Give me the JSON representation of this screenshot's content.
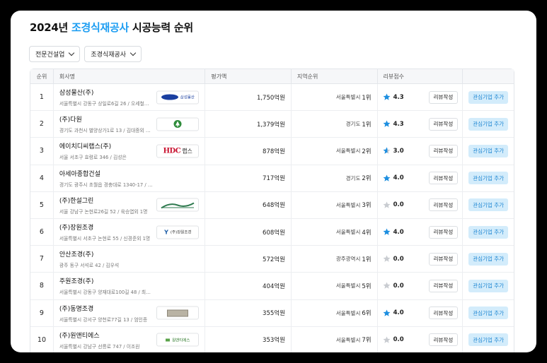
{
  "page": {
    "title_year": "2024년 ",
    "title_accent": "조경식재공사",
    "title_rest": " 시공능력 순위"
  },
  "filters": [
    {
      "label": "전문건설업"
    },
    {
      "label": "조경식재공사"
    }
  ],
  "colors": {
    "accent": "#1e9ef2",
    "star_active": "#1e8fe0",
    "star_inactive": "#c9ccd1",
    "fav_bg": "#d3ecfb"
  },
  "table": {
    "headers": {
      "rank": "순위",
      "name": "회사명",
      "score": "평가액",
      "region": "지역순위",
      "review": "리뷰점수"
    },
    "review_button": "리뷰작성",
    "fav_button": "관심기업 추가",
    "rows": [
      {
        "rank": "1",
        "name": "삼성물산(주)",
        "addr": "서울특별시 강동구 상일로6길 26 / 오세철…",
        "score": "1,750억원",
        "region": "서울특별시",
        "region_rank": "1위",
        "rating": "4.3",
        "star": "full",
        "logo": "samsung-cnt-logo",
        "logo_text": "삼성물산"
      },
      {
        "rank": "2",
        "name": "(주)다원",
        "addr": "경기도 과천시 별양상가1로 13 / 김대중외 …",
        "score": "1,379억원",
        "region": "경기도",
        "region_rank": "1위",
        "rating": "4.3",
        "star": "full",
        "logo": "tree-emblem-logo",
        "logo_text": ""
      },
      {
        "rank": "3",
        "name": "에이치디씨랩스(주)",
        "addr": "서울 서초구 효령로 346 / 김성은",
        "score": "878억원",
        "region": "서울특별시",
        "region_rank": "2위",
        "rating": "3.0",
        "star": "partial",
        "logo": "hdc-labs-logo",
        "logo_text": "랩스"
      },
      {
        "rank": "4",
        "name": "아세아종합건설",
        "addr": "경기도 광주시 초월읍 경충대로 1340-17 / …",
        "score": "717억원",
        "region": "경기도",
        "region_rank": "2위",
        "rating": "4.0",
        "star": "full",
        "logo": "",
        "logo_text": ""
      },
      {
        "rank": "5",
        "name": "(주)한설그린",
        "addr": "서울 강남구 논현로26길 52 / 육승엽외 1명",
        "score": "648억원",
        "region": "서울특별시",
        "region_rank": "3위",
        "rating": "0.0",
        "star": "empty",
        "logo": "hanseol-green-logo",
        "logo_text": ""
      },
      {
        "rank": "6",
        "name": "(주)장원조경",
        "addr": "서울특별시 서초구 논현로 55 / 신경준외 1명",
        "score": "608억원",
        "region": "서울특별시",
        "region_rank": "4위",
        "rating": "4.0",
        "star": "full",
        "logo": "jangwon-logo",
        "logo_text": "(주)장원조경"
      },
      {
        "rank": "7",
        "name": "안산조경(주)",
        "addr": "광주 동구 서석로 42 / 김우석",
        "score": "572억원",
        "region": "광주광역시",
        "region_rank": "1위",
        "rating": "0.0",
        "star": "empty",
        "logo": "",
        "logo_text": ""
      },
      {
        "rank": "8",
        "name": "주원조경(주)",
        "addr": "서울특별시 강동구 양재대로100길 48 / 최…",
        "score": "404억원",
        "region": "서울특별시",
        "region_rank": "5위",
        "rating": "0.0",
        "star": "empty",
        "logo": "",
        "logo_text": ""
      },
      {
        "rank": "9",
        "name": "(주)동명조경",
        "addr": "서울특별시 강서구 양천로77길 13 / 엄인종",
        "score": "355억원",
        "region": "서울특별시",
        "region_rank": "6위",
        "rating": "4.0",
        "star": "full",
        "logo": "dongmyung-logo",
        "logo_text": ""
      },
      {
        "rank": "10",
        "name": "(주)원앤티에스",
        "addr": "서울특별시 강남구 선릉로 747 / 이조원",
        "score": "353억원",
        "region": "서울특별시",
        "region_rank": "7위",
        "rating": "0.0",
        "star": "empty",
        "logo": "one-nts-logo",
        "logo_text": "원앤티에스"
      }
    ]
  }
}
